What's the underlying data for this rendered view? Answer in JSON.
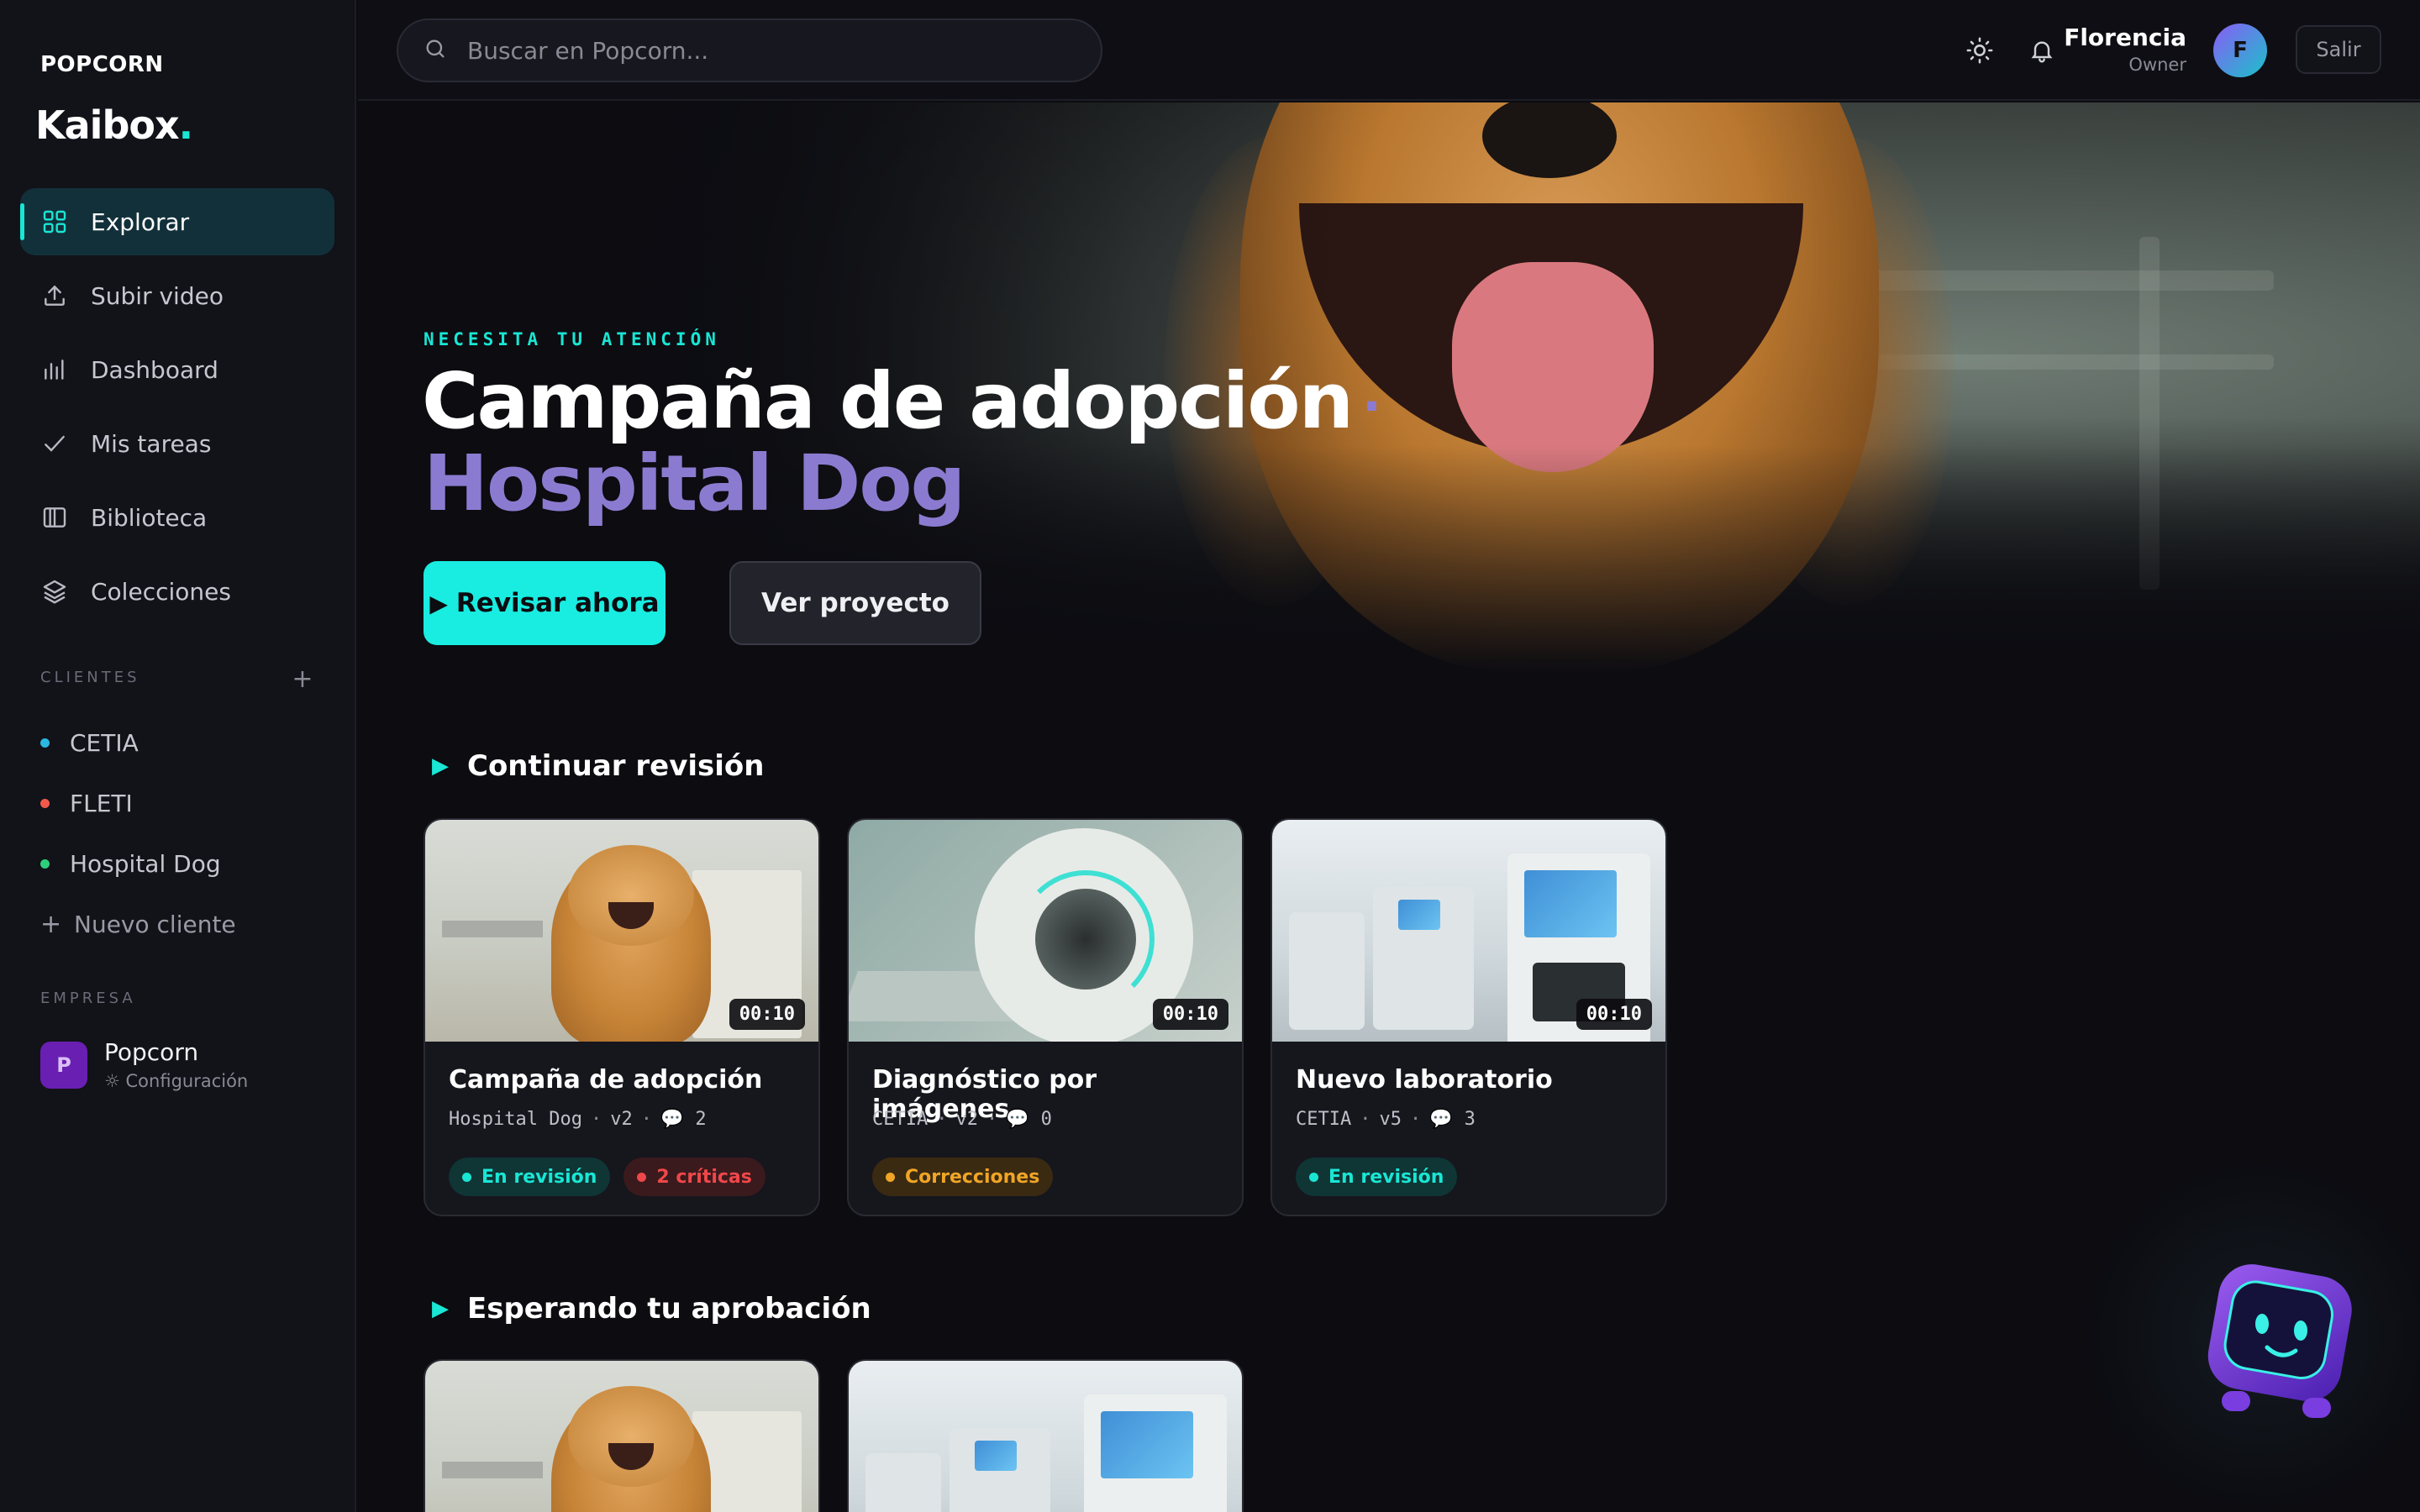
{
  "brand": {
    "parent": "POPCORN",
    "name": "Kaibox",
    "dot": "."
  },
  "nav": [
    {
      "label": "Explorar",
      "icon": "grid-icon",
      "active": true
    },
    {
      "label": "Subir video",
      "icon": "upload-icon"
    },
    {
      "label": "Dashboard",
      "icon": "bar-chart-icon"
    },
    {
      "label": "Mis tareas",
      "icon": "check-icon"
    },
    {
      "label": "Biblioteca",
      "icon": "library-icon"
    },
    {
      "label": "Colecciones",
      "icon": "layers-icon"
    }
  ],
  "clients": {
    "label": "CLIENTES",
    "items": [
      {
        "name": "CETIA",
        "color": "#2ab8e0"
      },
      {
        "name": "FLETI",
        "color": "#f05a4a"
      },
      {
        "name": "Hospital Dog",
        "color": "#2ecf7a"
      }
    ],
    "add_label": "Nuevo cliente"
  },
  "company": {
    "label": "EMPRESA",
    "initial": "P",
    "name": "Popcorn",
    "settings": "Configuración"
  },
  "search": {
    "placeholder": "Buscar en Popcorn..."
  },
  "user": {
    "name": "Florencia",
    "role": "Owner",
    "initial": "F",
    "logout": "Salir"
  },
  "hero": {
    "eyebrow": "NECESITA TU ATENCIÓN",
    "title": "Campaña de adopción",
    "separator": "·",
    "subtitle": "Hospital Dog",
    "primary_button": "Revisar ahora",
    "secondary_button": "Ver proyecto"
  },
  "sections": {
    "continue": {
      "title": "Continuar revisión",
      "cards": [
        {
          "title": "Campaña de adopción",
          "client": "Hospital Dog",
          "version": "v2",
          "comments": "2",
          "duration": "00:10",
          "badges": [
            {
              "label": "En revisión",
              "color": "#19e6d4"
            },
            {
              "label": "2 críticas",
              "color": "#f0474a"
            }
          ]
        },
        {
          "title": "Diagnóstico por imágenes",
          "client": "CETIA",
          "version": "v2",
          "comments": "0",
          "duration": "00:10",
          "badges": [
            {
              "label": "Correcciones",
              "color": "#f0a526"
            }
          ]
        },
        {
          "title": "Nuevo laboratorio",
          "client": "CETIA",
          "version": "v5",
          "comments": "3",
          "duration": "00:10",
          "badges": [
            {
              "label": "En revisión",
              "color": "#19e6d4"
            }
          ]
        }
      ]
    },
    "approval": {
      "title": "Esperando tu aprobación"
    }
  },
  "colors": {
    "accent": "#19e6d4",
    "violet": "#8b7bd0",
    "background": "#0c0c11",
    "sidebar": "#121219"
  }
}
